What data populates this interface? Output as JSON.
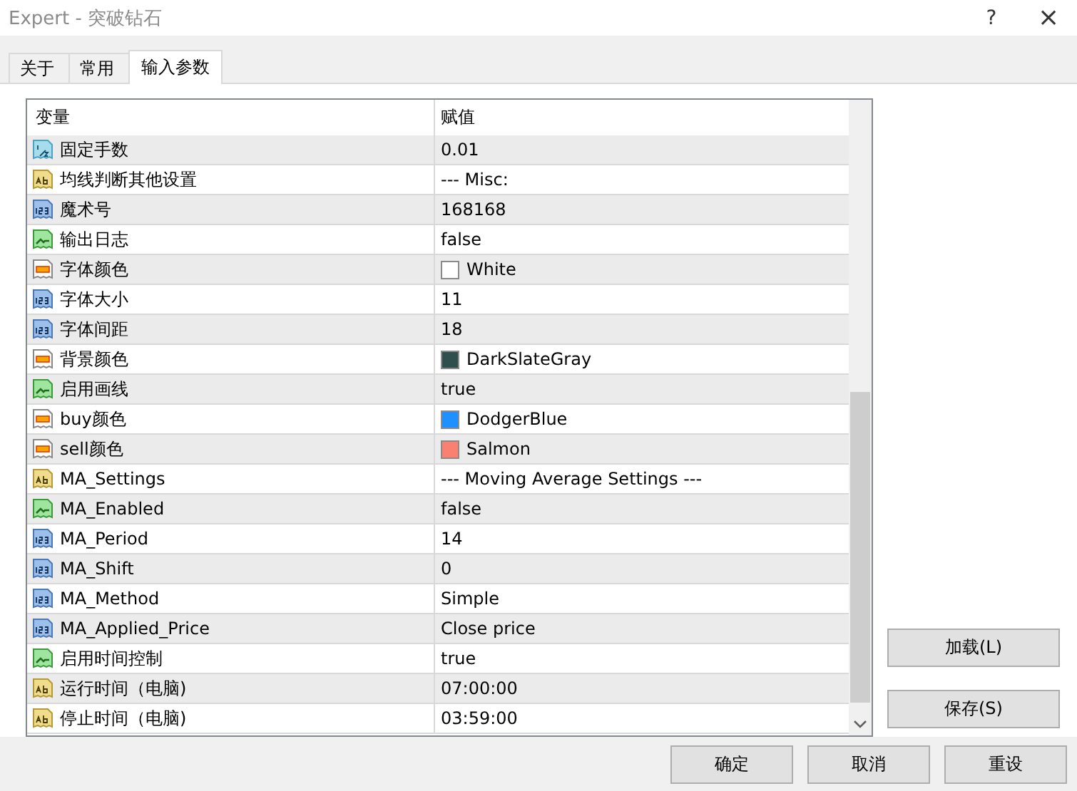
{
  "window": {
    "title": "Expert - 突破钻石",
    "help": "?",
    "close": "×"
  },
  "tabs": [
    {
      "label": "关于",
      "selected": false
    },
    {
      "label": "常用",
      "selected": false
    },
    {
      "label": "输入参数",
      "selected": true
    }
  ],
  "table": {
    "columns": [
      "变量",
      "赋值"
    ],
    "rows": [
      {
        "kind": "double",
        "name": "固定手数",
        "value": "0.01"
      },
      {
        "kind": "string",
        "name": "均线判断其他设置",
        "value": "--- Misc:"
      },
      {
        "kind": "int",
        "name": "魔术号",
        "value": "168168"
      },
      {
        "kind": "bool",
        "name": "输出日志",
        "value": "false"
      },
      {
        "kind": "color",
        "name": "字体颜色",
        "value": "White",
        "color": "#ffffff"
      },
      {
        "kind": "int",
        "name": "字体大小",
        "value": "11"
      },
      {
        "kind": "int",
        "name": "字体间距",
        "value": "18"
      },
      {
        "kind": "color",
        "name": "背景颜色",
        "value": "DarkSlateGray",
        "color": "#2f4f4f"
      },
      {
        "kind": "bool",
        "name": "启用画线",
        "value": "true"
      },
      {
        "kind": "color",
        "name": "buy颜色",
        "value": "DodgerBlue",
        "color": "#1e90ff"
      },
      {
        "kind": "color",
        "name": "sell颜色",
        "value": "Salmon",
        "color": "#fa8072"
      },
      {
        "kind": "string",
        "name": "MA_Settings",
        "value": "--- Moving Average Settings ---"
      },
      {
        "kind": "bool",
        "name": "MA_Enabled",
        "value": "false"
      },
      {
        "kind": "int",
        "name": "MA_Period",
        "value": "14"
      },
      {
        "kind": "int",
        "name": "MA_Shift",
        "value": "0"
      },
      {
        "kind": "int",
        "name": "MA_Method",
        "value": "Simple"
      },
      {
        "kind": "int",
        "name": "MA_Applied_Price",
        "value": "Close price"
      },
      {
        "kind": "bool",
        "name": "启用时间控制",
        "value": "true"
      },
      {
        "kind": "string",
        "name": "运行时间（电脑)",
        "value": "07:00:00"
      },
      {
        "kind": "string",
        "name": "停止时间（电脑)",
        "value": "03:59:00"
      }
    ]
  },
  "side_buttons": [
    "加载(L)",
    "保存(S)"
  ],
  "buttons": [
    "确定",
    "取消",
    "重设"
  ]
}
